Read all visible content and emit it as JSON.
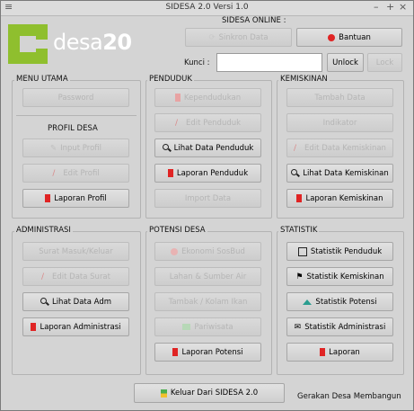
{
  "window": {
    "title": "SIDESA 2.0 Versi 1.0"
  },
  "logo": {
    "text_prefix": "desa",
    "text_suffix": "20"
  },
  "online": {
    "label": "SIDESA ONLINE :",
    "sync_label": "Sinkron Data",
    "help_label": "Bantuan",
    "key_label": "Kunci :",
    "key_value": "",
    "unlock_label": "Unlock",
    "lock_label": "Lock"
  },
  "groups": {
    "menu_utama": {
      "title": "MENU UTAMA",
      "password": "Password",
      "profil_title": "PROFIL DESA",
      "input_profil": "Input Profil",
      "edit_profil": "Edit Profil",
      "laporan_profil": "Laporan Profil"
    },
    "penduduk": {
      "title": "PENDUDUK",
      "kependudukan": "Kependudukan",
      "edit_penduduk": "Edit Penduduk",
      "lihat_data": "Lihat Data Penduduk",
      "laporan": "Laporan Penduduk",
      "import": "Import Data"
    },
    "kemiskinan": {
      "title": "KEMISKINAN",
      "tambah": "Tambah Data",
      "indikator": "Indikator",
      "edit": "Edit Data Kemiskinan",
      "lihat": "Lihat Data Kemiskinan",
      "laporan": "Laporan Kemiskinan"
    },
    "administrasi": {
      "title": "ADMINISTRASI",
      "surat": "Surat Masuk/Keluar",
      "edit_surat": "Edit Data Surat",
      "lihat": "Lihat Data Adm",
      "laporan": "Laporan Administrasi"
    },
    "potensi": {
      "title": "POTENSI DESA",
      "ekonomi": "Ekonomi SosBud",
      "lahan": "Lahan & Sumber Air",
      "tambak": "Tambak / Kolam Ikan",
      "pariwisata": "Pariwisata",
      "laporan": "Laporan Potensi"
    },
    "statistik": {
      "title": "STATISTIK",
      "penduduk": "Statistik Penduduk",
      "kemiskinan": "Statistik Kemiskinan",
      "potensi": "Statistik Potensi",
      "administrasi": "Statistik Administrasi",
      "laporan": "Laporan"
    }
  },
  "exit_label": "Keluar Dari SIDESA 2.0",
  "footer": "Gerakan Desa Membangun",
  "colors": {
    "logo_green": "#8fbf2e",
    "report_red": "#e02424"
  }
}
